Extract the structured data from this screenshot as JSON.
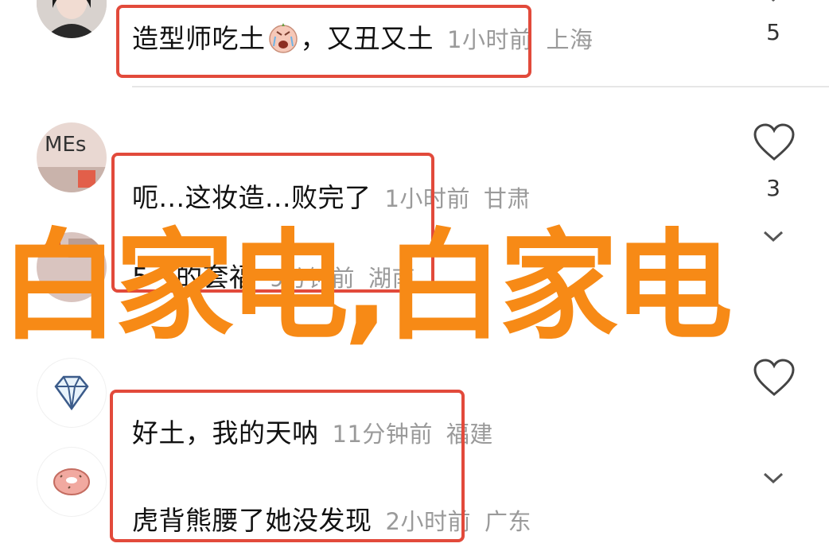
{
  "comments": [
    {
      "text_before": "造型师吃土",
      "text_after": "，又丑又土",
      "time": "1小时前",
      "location": "上海",
      "likes": "5"
    },
    {
      "text": "呃...这妆造...败完了",
      "time": "1小时前",
      "location": "甘肃",
      "likes": "3"
    },
    {
      "text": "5一的套福",
      "time": "9分钟前",
      "location": "湖南"
    },
    {
      "text": "好土，我的天呐",
      "time": "11分钟前",
      "location": "福建"
    },
    {
      "text": "虎背熊腰了她没发现",
      "time": "2小时前",
      "location": "广东"
    }
  ],
  "avatar_text": "MEs",
  "watermark": "白家电,白家电",
  "colors": {
    "highlight": "#e24a3b",
    "watermark": "#f78a16",
    "meta": "#9a9a9a"
  },
  "icons": [
    "heart-icon",
    "chevron-down-icon",
    "diamond-icon",
    "donut-icon",
    "crying-emoji-icon"
  ]
}
